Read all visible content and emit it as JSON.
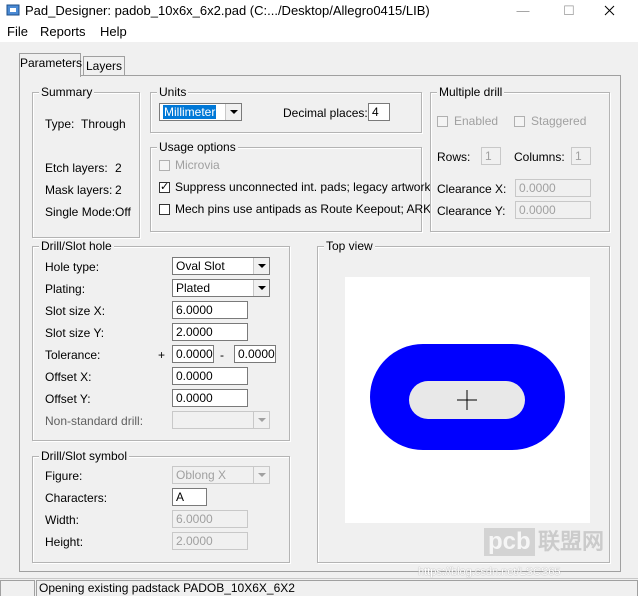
{
  "window": {
    "title": "Pad_Designer: padob_10x6x_6x2.pad (C:.../Desktop/Allegro0415/LIB)",
    "minimize": "—",
    "maximize": "☐"
  },
  "menu": {
    "file": "File",
    "reports": "Reports",
    "help": "Help"
  },
  "tabs": {
    "parameters": "Parameters",
    "layers": "Layers"
  },
  "summary": {
    "title": "Summary",
    "type_label": "Type:",
    "type_value": "Through",
    "etch_label": "Etch layers:",
    "etch_value": "2",
    "mask_label": "Mask layers:",
    "mask_value": "2",
    "single_label": "Single Mode:",
    "single_value": "Off"
  },
  "units": {
    "title": "Units",
    "selected": "Millimeter",
    "decimal_label": "Decimal places:",
    "decimal_value": "4"
  },
  "usage": {
    "title": "Usage options",
    "microvia": "Microvia",
    "suppress": "Suppress unconnected int. pads; legacy artwork",
    "mech": "Mech pins use antipads as Route Keepout; ARK"
  },
  "multi_drill": {
    "title": "Multiple drill",
    "enabled": "Enabled",
    "staggered": "Staggered",
    "rows_label": "Rows:",
    "rows_value": "1",
    "cols_label": "Columns:",
    "cols_value": "1",
    "clear_x_label": "Clearance X:",
    "clear_x_value": "0.0000",
    "clear_y_label": "Clearance Y:",
    "clear_y_value": "0.0000"
  },
  "drill": {
    "title": "Drill/Slot hole",
    "hole_type_label": "Hole type:",
    "hole_type": "Oval Slot",
    "plating_label": "Plating:",
    "plating": "Plated",
    "slot_x_label": "Slot size X:",
    "slot_x": "6.0000",
    "slot_y_label": "Slot size Y:",
    "slot_y": "2.0000",
    "tol_label": "Tolerance:",
    "tol_plus": "+",
    "tol_plus_value": "0.0000",
    "tol_minus": "-",
    "tol_minus_value": "0.0000",
    "off_x_label": "Offset X:",
    "off_x": "0.0000",
    "off_y_label": "Offset Y:",
    "off_y": "0.0000",
    "nonstd_label": "Non-standard drill:",
    "nonstd": ""
  },
  "symbol": {
    "title": "Drill/Slot symbol",
    "figure_label": "Figure:",
    "figure": "Oblong X",
    "chars_label": "Characters:",
    "chars": "A",
    "width_label": "Width:",
    "width": "6.0000",
    "height_label": "Height:",
    "height": "2.0000"
  },
  "top_view": {
    "title": "Top view",
    "pad_color": "#0000ff",
    "hole_color": "#e8e8e8"
  },
  "status": {
    "message": "Opening existing padstack PADOB_10X6X_6X2"
  },
  "watermark": {
    "brand": "pcb",
    "brand_cn": "联盟网",
    "url": "https://blog.csdn.net/LSCS65"
  }
}
